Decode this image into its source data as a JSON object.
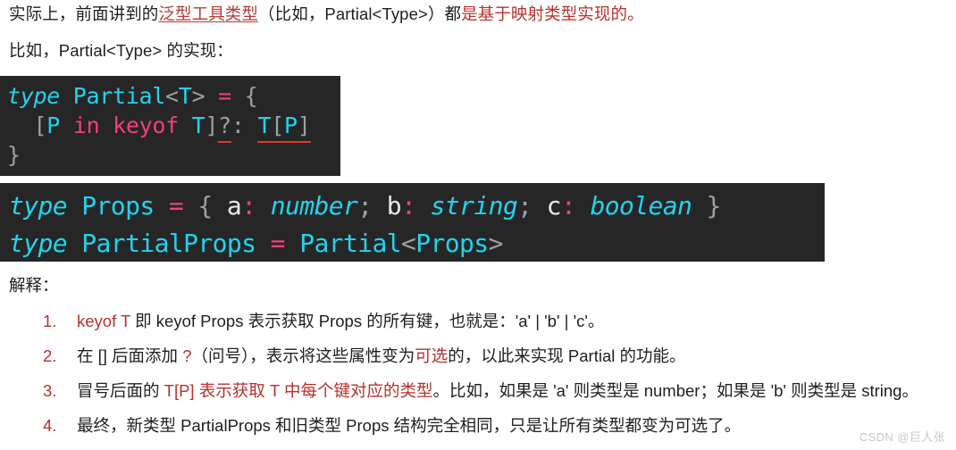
{
  "page": {
    "background": "#ffffff",
    "accent_red": "#b6322c",
    "link_red": "#b23c34",
    "code_bg": "#262626",
    "code_cyan": "#22d3ee",
    "code_pink": "#f0407a",
    "code_gray": "#9aa0a6",
    "code_white": "#e8e8e8",
    "underline_red": "#e03a28"
  },
  "paragraphs": {
    "p1": {
      "seg1": "实际上，前面讲到的",
      "link": "泛型工具类型",
      "seg2": "（比如，Partial<Type>）都",
      "red": "是基于映射类型实现的。"
    },
    "p2": {
      "text": "比如，Partial<Type> 的实现："
    }
  },
  "code_block_1": {
    "language": "typescript",
    "lines": [
      {
        "tokens": [
          {
            "t": "type",
            "c": "kw"
          },
          {
            "t": " ",
            "c": "plain"
          },
          {
            "t": "Partial",
            "c": "type"
          },
          {
            "t": "<",
            "c": "punct"
          },
          {
            "t": "T",
            "c": "type"
          },
          {
            "t": ">",
            "c": "punct"
          },
          {
            "t": " ",
            "c": "plain"
          },
          {
            "t": "=",
            "c": "op"
          },
          {
            "t": " ",
            "c": "plain"
          },
          {
            "t": "{",
            "c": "punct"
          }
        ]
      },
      {
        "tokens": [
          {
            "t": "  ",
            "c": "plain"
          },
          {
            "t": "[",
            "c": "punct"
          },
          {
            "t": "P",
            "c": "type"
          },
          {
            "t": " ",
            "c": "plain"
          },
          {
            "t": "in",
            "c": "in"
          },
          {
            "t": " ",
            "c": "plain"
          },
          {
            "t": "keyof",
            "c": "in"
          },
          {
            "t": " ",
            "c": "plain"
          },
          {
            "t": "T",
            "c": "type"
          },
          {
            "t": "]",
            "c": "punct"
          },
          {
            "t": "?",
            "c": "punct",
            "underline": true
          },
          {
            "t": ":",
            "c": "punct"
          },
          {
            "t": " ",
            "c": "plain"
          },
          {
            "t": "T[P]",
            "c": "mixed-tp",
            "underline": true
          }
        ]
      },
      {
        "tokens": [
          {
            "t": "}",
            "c": "punct"
          }
        ]
      }
    ]
  },
  "code_block_2": {
    "language": "typescript",
    "lines": [
      {
        "tokens": [
          {
            "t": "type",
            "c": "kw"
          },
          {
            "t": " ",
            "c": "plain"
          },
          {
            "t": "Props",
            "c": "type"
          },
          {
            "t": " ",
            "c": "plain"
          },
          {
            "t": "=",
            "c": "op"
          },
          {
            "t": " ",
            "c": "plain"
          },
          {
            "t": "{",
            "c": "punct"
          },
          {
            "t": " ",
            "c": "plain"
          },
          {
            "t": "a",
            "c": "prop"
          },
          {
            "t": ":",
            "c": "op"
          },
          {
            "t": " ",
            "c": "plain"
          },
          {
            "t": "number",
            "c": "type-i"
          },
          {
            "t": ";",
            "c": "punct"
          },
          {
            "t": " ",
            "c": "plain"
          },
          {
            "t": "b",
            "c": "prop"
          },
          {
            "t": ":",
            "c": "op"
          },
          {
            "t": " ",
            "c": "plain"
          },
          {
            "t": "string",
            "c": "type-i"
          },
          {
            "t": ";",
            "c": "punct"
          },
          {
            "t": " ",
            "c": "plain"
          },
          {
            "t": "c",
            "c": "prop"
          },
          {
            "t": ":",
            "c": "op"
          },
          {
            "t": " ",
            "c": "plain"
          },
          {
            "t": "boolean",
            "c": "type-i"
          },
          {
            "t": " ",
            "c": "plain"
          },
          {
            "t": "}",
            "c": "punct"
          }
        ]
      },
      {
        "tokens": [
          {
            "t": "type",
            "c": "kw"
          },
          {
            "t": " ",
            "c": "plain"
          },
          {
            "t": "PartialProps",
            "c": "type"
          },
          {
            "t": " ",
            "c": "plain"
          },
          {
            "t": "=",
            "c": "op"
          },
          {
            "t": " ",
            "c": "plain"
          },
          {
            "t": "Partial",
            "c": "type"
          },
          {
            "t": "<",
            "c": "punct"
          },
          {
            "t": "Props",
            "c": "type"
          },
          {
            "t": ">",
            "c": "punct"
          }
        ]
      }
    ]
  },
  "explanation": {
    "label": "解释：",
    "items": [
      {
        "num": "1.",
        "parts": [
          {
            "t": "keyof T",
            "red": true
          },
          {
            "t": " 即 keyof Props 表示获取 Props 的所有键，也就是：'a' | 'b' | 'c'。",
            "red": false
          }
        ]
      },
      {
        "num": "2.",
        "parts": [
          {
            "t": "在 [] 后面添加 ",
            "red": false
          },
          {
            "t": "?",
            "red": true
          },
          {
            "t": "（问号），表示将这些属性变为",
            "red": false
          },
          {
            "t": "可选",
            "red": true
          },
          {
            "t": "的，以此来实现 Partial 的功能。",
            "red": false
          }
        ]
      },
      {
        "num": "3.",
        "parts": [
          {
            "t": "冒号后面的 ",
            "red": false
          },
          {
            "t": "T[P] 表示获取 T 中每个键对应的类型",
            "red": true
          },
          {
            "t": "。比如，如果是 'a' 则类型是 number；如果是 'b' 则类型是 string。",
            "red": false
          }
        ]
      },
      {
        "num": "4.",
        "parts": [
          {
            "t": "最终，新类型 PartialProps 和旧类型 Props 结构完全相同，只是让所有类型都变为可选了。",
            "red": false
          }
        ]
      }
    ]
  },
  "watermark": {
    "text": "CSDN @巨人张"
  }
}
